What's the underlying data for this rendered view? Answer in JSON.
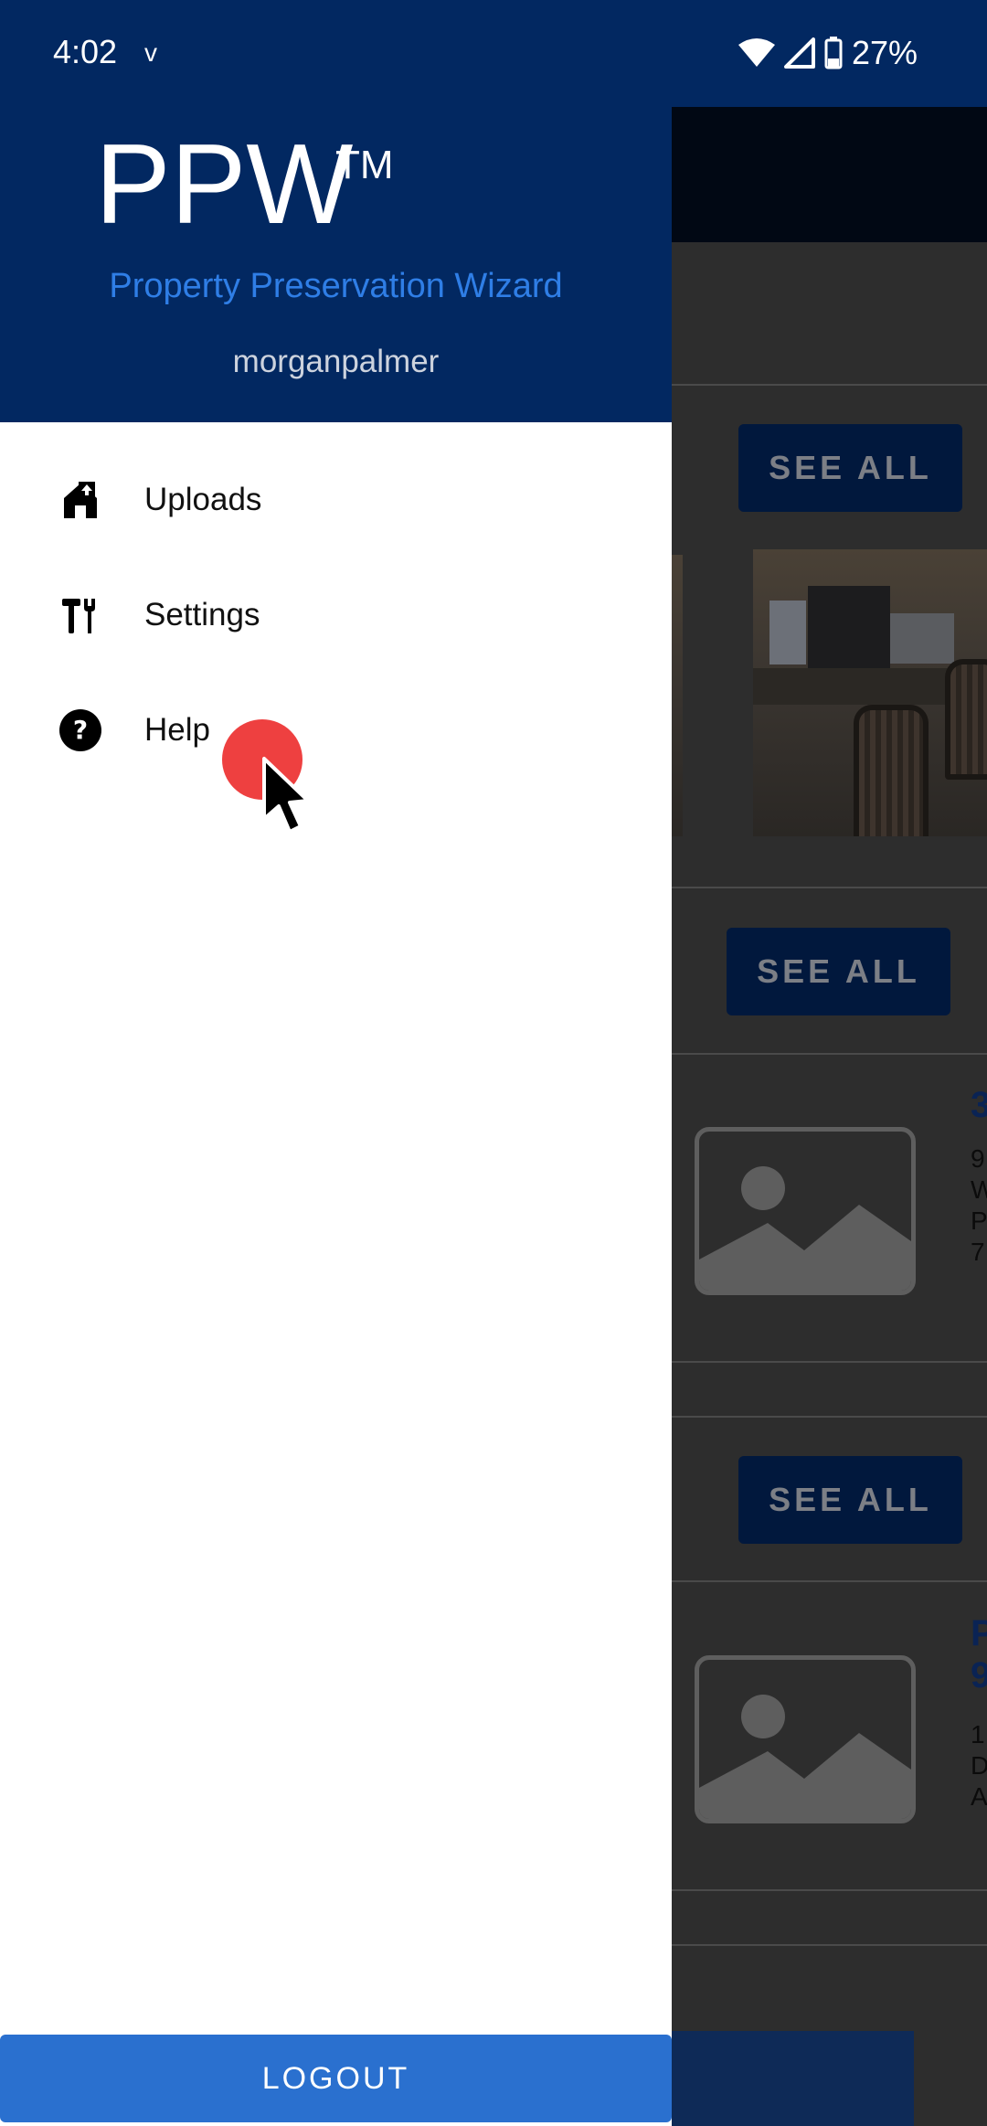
{
  "status_bar": {
    "time": "4:02",
    "carrier_glyph": "v",
    "battery": "27%",
    "icons": [
      "wifi-icon",
      "signal-icon",
      "battery-icon"
    ]
  },
  "drawer": {
    "brand": "PPW",
    "trademark": "TM",
    "subtitle": "Property Preservation Wizard",
    "username": "morganpalmer",
    "items": [
      {
        "label": "Uploads",
        "icon": "home-upload-icon"
      },
      {
        "label": "Settings",
        "icon": "tools-icon"
      },
      {
        "label": "Help",
        "icon": "help-icon"
      }
    ],
    "logout_label": "LOGOUT"
  },
  "background": {
    "see_all_labels": [
      "SEE ALL",
      "SEE ALL",
      "SEE ALL"
    ],
    "card1_visible_title_fragment": "3",
    "card1_visible_lines": [
      "9",
      "W",
      "P",
      "7"
    ],
    "card2_visible_title_fragment": [
      "P",
      "9"
    ],
    "card2_visible_lines": [
      "1",
      "D",
      "A"
    ]
  },
  "colors": {
    "header_navy": "#022861",
    "accent_blue": "#2f7ee6",
    "logout_blue": "#2a70cf",
    "touch_indicator": "#ee4040"
  }
}
